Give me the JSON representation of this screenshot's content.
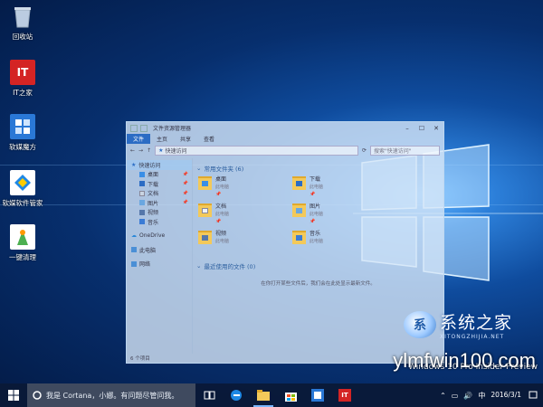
{
  "desktop": {
    "icons": [
      {
        "label": "回收站",
        "icon": "recycle-bin-icon"
      },
      {
        "label": "IT之家",
        "icon": "ithome-app-icon",
        "badge": "IT"
      },
      {
        "label": "软媒魔方",
        "icon": "ruanmei-mofang-icon"
      },
      {
        "label": "软媒软件管家",
        "icon": "ruanmei-software-manager-icon"
      },
      {
        "label": "一键清理",
        "icon": "one-click-clean-icon"
      }
    ]
  },
  "explorer": {
    "title": "文件资源管理器",
    "ribbon_tabs": [
      "文件",
      "主页",
      "共享",
      "查看"
    ],
    "address": "快速访问",
    "search_placeholder": "搜索\"快速访问\"",
    "nav": [
      {
        "label": "快速访问",
        "icon": "star-icon",
        "selected": true,
        "sub": false,
        "color": "#2b6cc4"
      },
      {
        "label": "桌面",
        "icon": "desktop-icon",
        "sub": true,
        "pinned": true,
        "color": "#3a8ee6"
      },
      {
        "label": "下载",
        "icon": "download-icon",
        "sub": true,
        "pinned": true,
        "color": "#2b6cc4"
      },
      {
        "label": "文档",
        "icon": "document-icon",
        "sub": true,
        "pinned": true,
        "color": "#c9d4e2"
      },
      {
        "label": "图片",
        "icon": "picture-icon",
        "sub": true,
        "pinned": true,
        "color": "#6aa7e0"
      },
      {
        "label": "视频",
        "icon": "video-icon",
        "sub": true,
        "color": "#5577aa"
      },
      {
        "label": "音乐",
        "icon": "music-icon",
        "sub": true,
        "color": "#3a7bd5"
      },
      {
        "label": "OneDrive",
        "icon": "onedrive-icon",
        "sub": false,
        "color": "#2b88d8"
      },
      {
        "label": "此电脑",
        "icon": "this-pc-icon",
        "sub": false,
        "color": "#4a8fd6"
      },
      {
        "label": "网络",
        "icon": "network-icon",
        "sub": false,
        "color": "#4a8fd6"
      }
    ],
    "frequent_header": "常用文件夹 (6)",
    "folders": [
      {
        "name": "桌面",
        "location": "此电脑",
        "icon": "desktop-folder-icon"
      },
      {
        "name": "下载",
        "location": "此电脑",
        "icon": "download-folder-icon"
      },
      {
        "name": "文档",
        "location": "此电脑",
        "icon": "documents-folder-icon"
      },
      {
        "name": "图片",
        "location": "此电脑",
        "icon": "pictures-folder-icon"
      },
      {
        "name": "视频",
        "location": "此电脑",
        "icon": "videos-folder-icon"
      },
      {
        "name": "音乐",
        "location": "此电脑",
        "icon": "music-folder-icon"
      }
    ],
    "recent_header": "最近使用的文件 (0)",
    "recent_empty": "在你打开某些文件后，我们会在此处显示最新文件。",
    "status": "6 个项目"
  },
  "watermark": {
    "brand_cn": "系统之家",
    "brand_en": "XITONGZHIJIA.NET",
    "site": "ylmfwin100.com"
  },
  "build_text": "Windows 10 Pro Insider Preview",
  "taskbar": {
    "cortana_text": "我是 Cortana，小娜。有问题尽管问我。",
    "apps": [
      {
        "name": "task-view-icon",
        "active": false
      },
      {
        "name": "edge-icon",
        "active": false
      },
      {
        "name": "file-explorer-icon",
        "active": true
      },
      {
        "name": "store-icon",
        "active": false
      },
      {
        "name": "ruanmei-mofang-taskbar-icon",
        "active": false
      },
      {
        "name": "ithome-taskbar-icon",
        "active": false,
        "badge": "IT"
      }
    ],
    "ime": "中",
    "date": "2016/3/1"
  }
}
